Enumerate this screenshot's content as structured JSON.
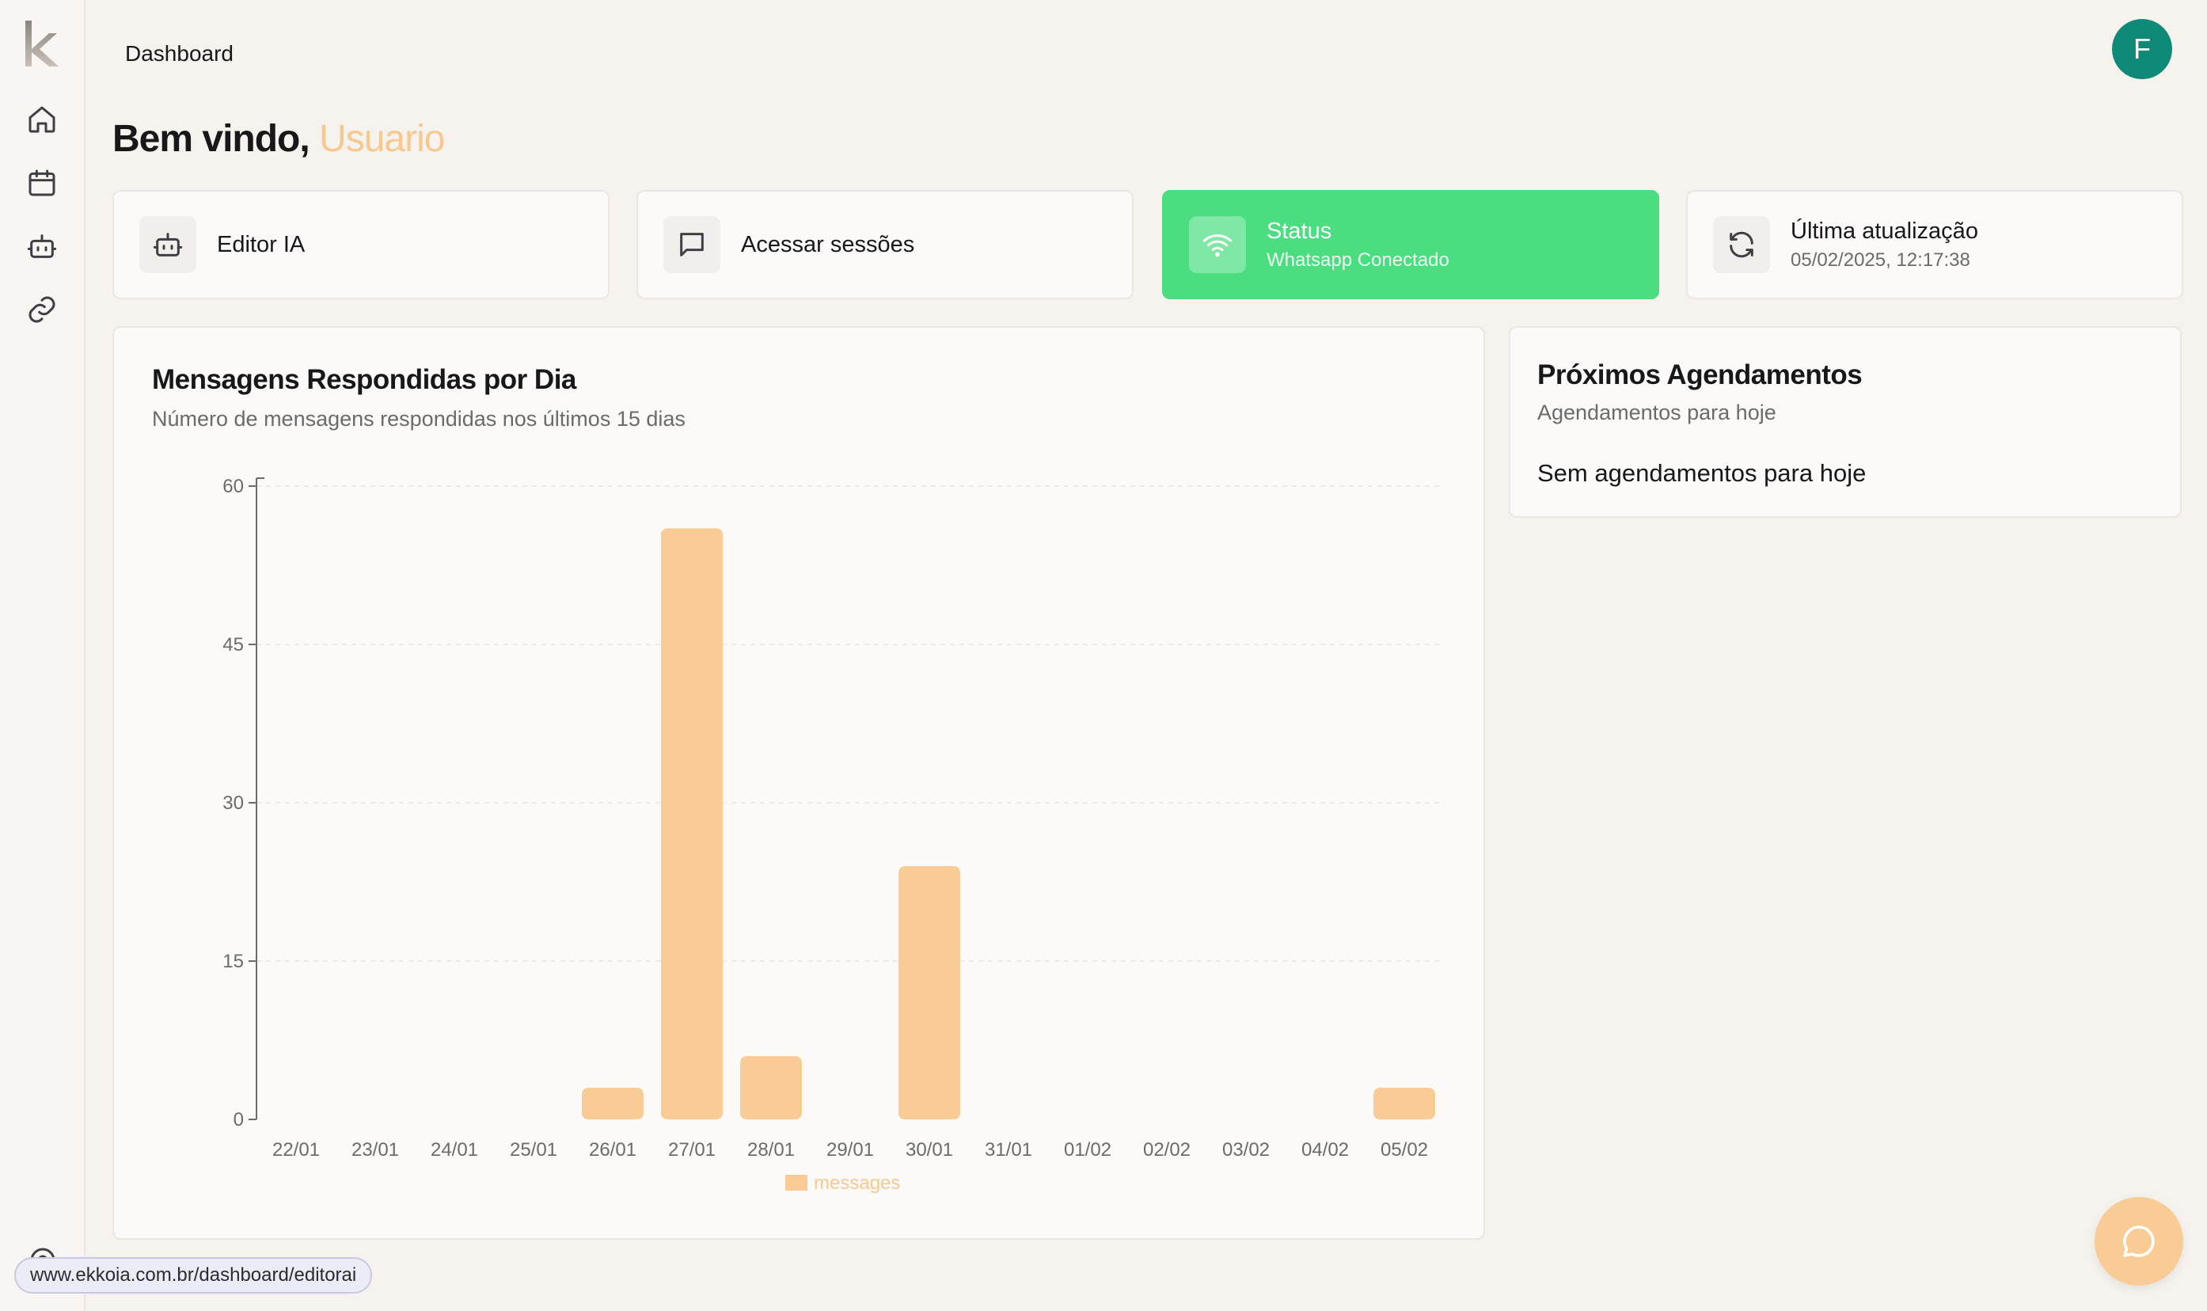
{
  "header": {
    "title": "Dashboard",
    "avatar_letter": "F"
  },
  "sidebar": {
    "items": [
      {
        "name": "home",
        "icon": "home-icon"
      },
      {
        "name": "calendar",
        "icon": "calendar-icon"
      },
      {
        "name": "bot",
        "icon": "bot-icon"
      },
      {
        "name": "link",
        "icon": "link-icon"
      }
    ]
  },
  "welcome": {
    "greeting": "Bem vindo,",
    "user": "Usuario"
  },
  "cards": {
    "editor": {
      "label": "Editor IA",
      "icon": "bot-icon"
    },
    "sessions": {
      "label": "Acessar sessões",
      "icon": "message-square-icon"
    },
    "status": {
      "label": "Status",
      "sub": "Whatsapp Conectado",
      "icon": "wifi-icon"
    },
    "updated": {
      "label": "Última atualização",
      "sub": "05/02/2025, 12:17:38",
      "icon": "refresh-icon"
    }
  },
  "chart_panel": {
    "title": "Mensagens Respondidas por Dia",
    "subtitle": "Número de mensagens respondidas nos últimos 15 dias"
  },
  "chart_data": {
    "type": "bar",
    "categories": [
      "22/01",
      "23/01",
      "24/01",
      "25/01",
      "26/01",
      "27/01",
      "28/01",
      "29/01",
      "30/01",
      "31/01",
      "01/02",
      "02/02",
      "03/02",
      "04/02",
      "05/02"
    ],
    "series": [
      {
        "name": "messages",
        "values": [
          0,
          0,
          0,
          0,
          3,
          56,
          6,
          0,
          24,
          0,
          0,
          0,
          0,
          0,
          3
        ]
      }
    ],
    "ylim": [
      0,
      60
    ],
    "yticks": [
      0,
      15,
      30,
      45,
      60
    ],
    "grid": true,
    "legend": "bottom",
    "colors": {
      "bar": "#f9cc95",
      "legend_text": "#f7c98f"
    }
  },
  "schedule": {
    "title": "Próximos Agendamentos",
    "subtitle": "Agendamentos para hoje",
    "empty": "Sem agendamentos para hoje"
  },
  "status_bar": {
    "url": "www.ekkoia.com.br/dashboard/editorai"
  },
  "colors": {
    "accent": "#f7c98f",
    "status_green": "#4ade80",
    "avatar": "#0f8a78"
  }
}
